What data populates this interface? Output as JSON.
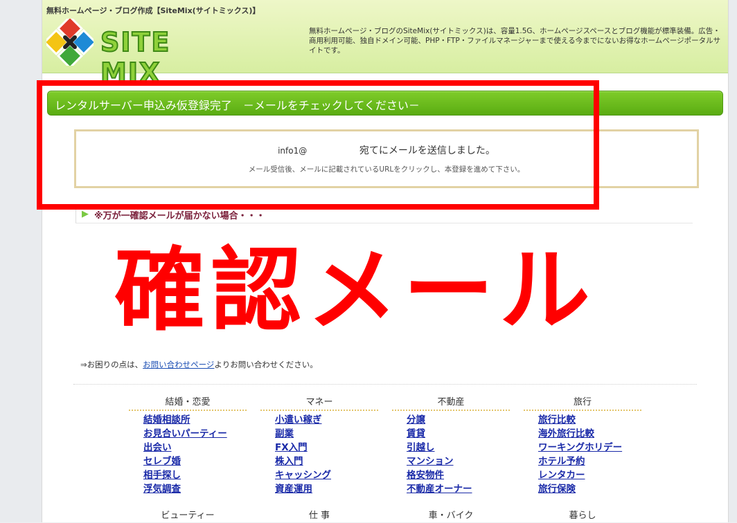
{
  "header": {
    "top_title": "無料ホームページ・ブログ作成【SiteMix(サイトミックス)】",
    "logo_text": "SITE MIX",
    "description": "無料ホームページ・ブログのSiteMix(サイトミックス)は、容量1.5G、ホームページスペースとブログ機能が標準装備。広告・商用利用可能、独自ドメイン可能、PHP・FTP・ファイルマネージャーまで使える今までにないお得なホームページポータルサイトです。"
  },
  "title_bar": {
    "text": "レンタルサーバー申込み仮登録完了　－メールをチェックしてください－"
  },
  "message": {
    "address": "info1@",
    "sent_text": "宛てにメールを送信しました。",
    "instruction": "メール受信後、メールに記載されているURLをクリックし、本登録を進めて下さい。"
  },
  "annotation": {
    "big_text": "確認メール",
    "color": "#ff0000"
  },
  "notice": {
    "arrow": "▶",
    "text": "※万が一確認メールが届かない場合・・・"
  },
  "contact": {
    "prefix": "⇒お困りの点は、",
    "link": "お問い合わせページ",
    "suffix": "よりお問い合わせください。"
  },
  "categories": [
    {
      "title": "結婚・恋愛",
      "links": [
        "結婚相談所",
        "お見合いパーティー",
        "出会い",
        "セレブ婚",
        "相手探し",
        "浮気調査"
      ]
    },
    {
      "title": "マネー",
      "links": [
        "小遣い稼ぎ",
        "副業",
        "FX入門",
        "株入門",
        "キャッシング",
        "資産運用"
      ]
    },
    {
      "title": "不動産",
      "links": [
        "分譲",
        "賃貸",
        "引越し",
        "マンション",
        "格安物件",
        "不動産オーナー"
      ]
    },
    {
      "title": "旅行",
      "links": [
        "旅行比較",
        "海外旅行比較",
        "ワーキングホリデー",
        "ホテル予約",
        "レンタカー",
        "旅行保険"
      ]
    }
  ],
  "categories_row2": [
    "ビューティー",
    "仕 事",
    "車・バイク",
    "暮らし"
  ],
  "colors": {
    "header_green": "#d7eea1",
    "title_bar_green": "#5aac12",
    "link_blue": "#1a2aa8",
    "notice_text": "#7a1f3a"
  }
}
